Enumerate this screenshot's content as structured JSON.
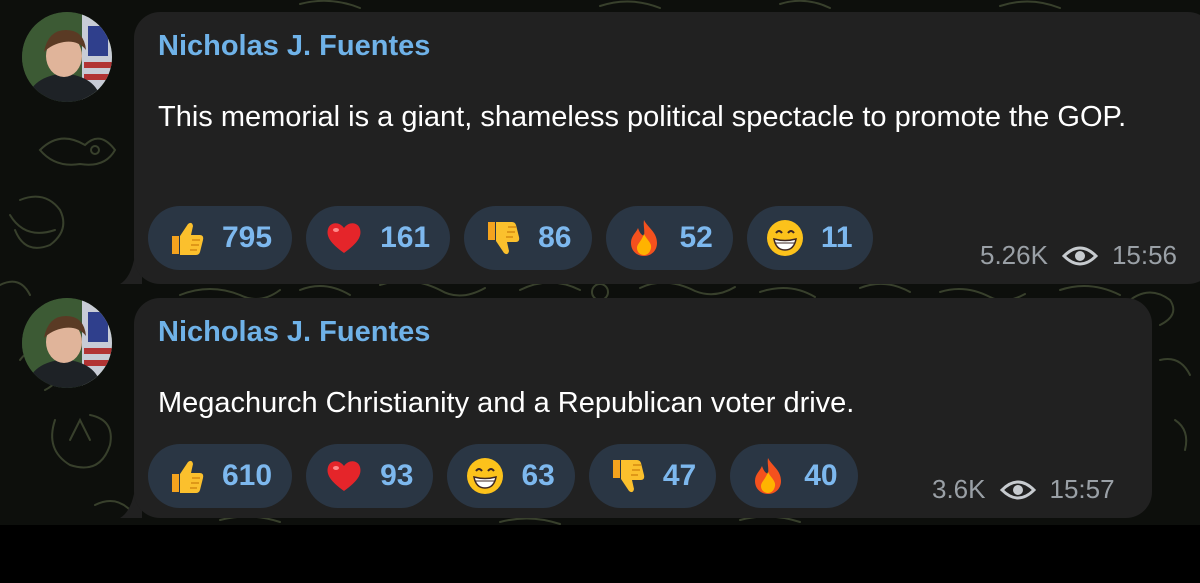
{
  "messages": [
    {
      "sender": "Nicholas J. Fuentes",
      "text": "This memorial is a giant, shameless political spectacle to promote the GOP.",
      "reactions": [
        {
          "icon": "thumbs-up-icon",
          "count": "795"
        },
        {
          "icon": "heart-icon",
          "count": "161"
        },
        {
          "icon": "thumbs-down-icon",
          "count": "86"
        },
        {
          "icon": "fire-icon",
          "count": "52"
        },
        {
          "icon": "grinning-face-icon",
          "count": "11"
        }
      ],
      "views": "5.26K",
      "time": "15:56"
    },
    {
      "sender": "Nicholas J. Fuentes",
      "text": "Megachurch Christianity and a Republican voter drive.",
      "reactions": [
        {
          "icon": "thumbs-up-icon",
          "count": "610"
        },
        {
          "icon": "heart-icon",
          "count": "93"
        },
        {
          "icon": "grinning-face-icon",
          "count": "63"
        },
        {
          "icon": "thumbs-down-icon",
          "count": "47"
        },
        {
          "icon": "fire-icon",
          "count": "40"
        }
      ],
      "views": "3.6K",
      "time": "15:57"
    }
  ],
  "colors": {
    "sender_name": "#6fb2e8",
    "bubble": "#212121",
    "reaction_pill": "#2a3644",
    "reaction_count": "#7db8ee",
    "meta": "#9aa0a6"
  }
}
